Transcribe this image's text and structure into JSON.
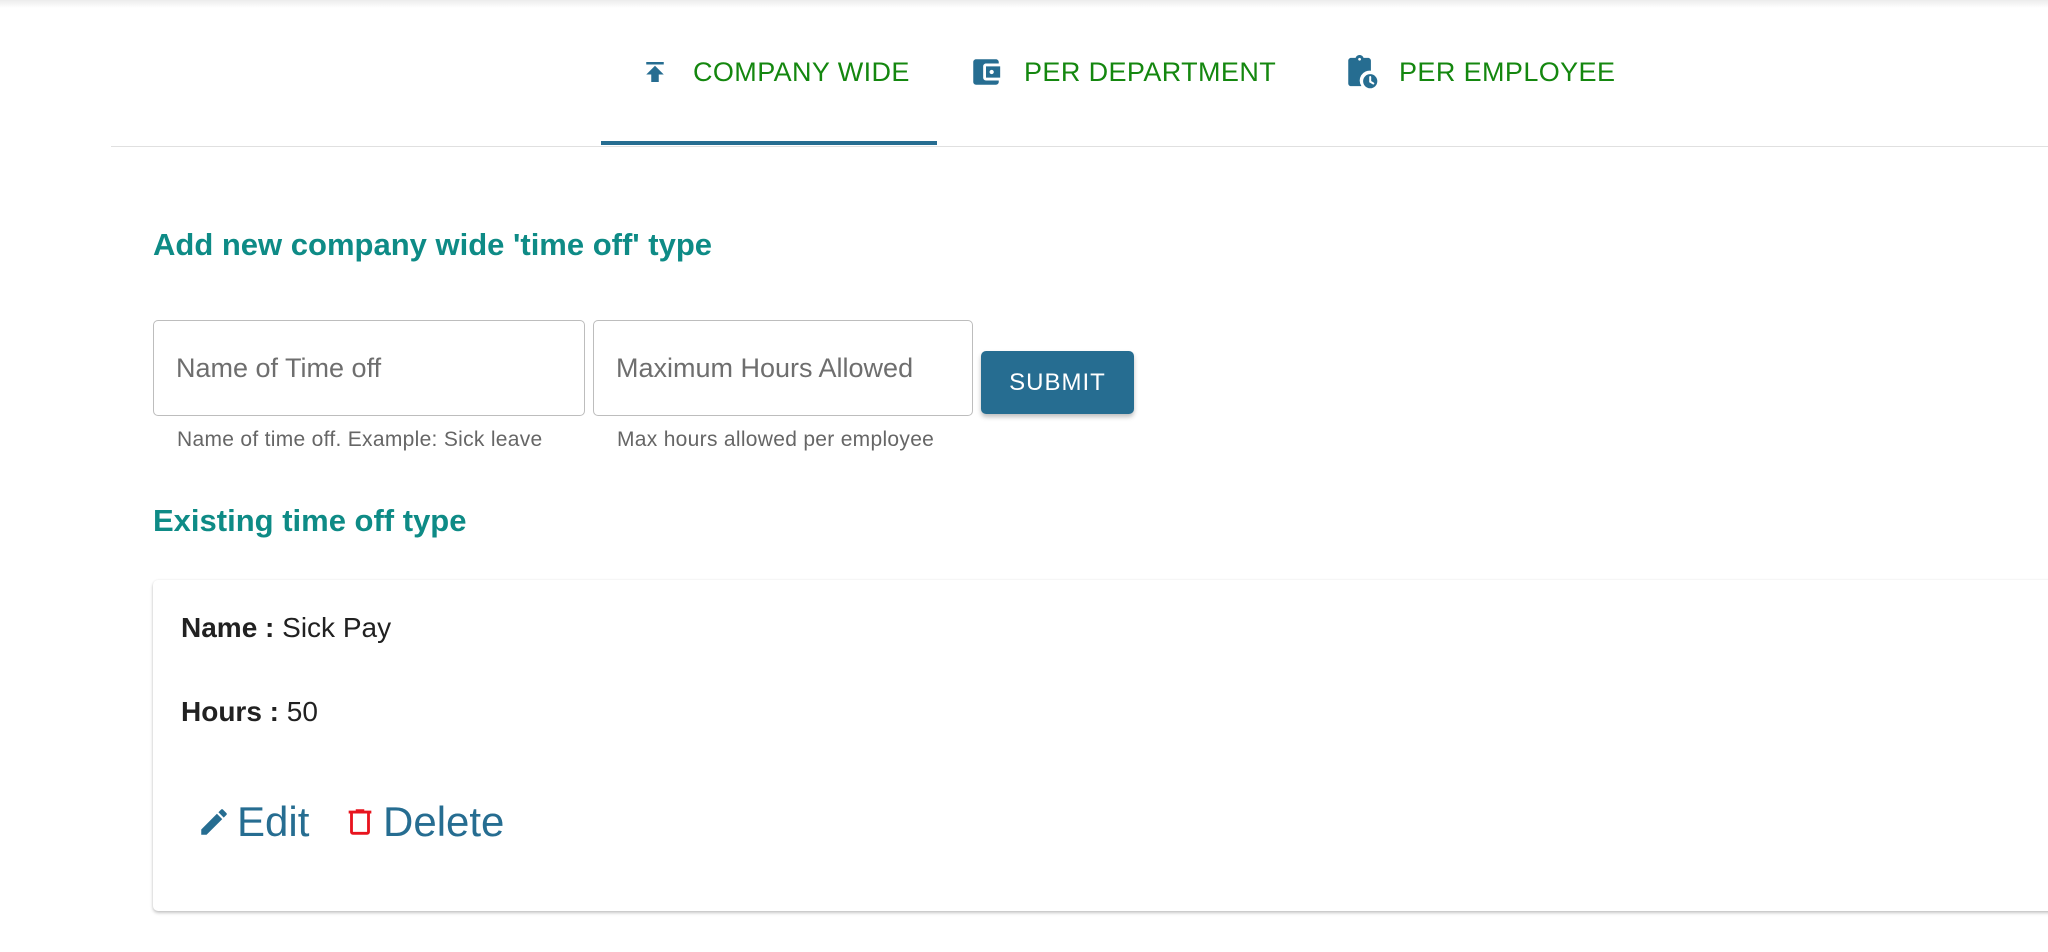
{
  "tabs": [
    {
      "label": "COMPANY WIDE",
      "icon": "upload-icon",
      "active": true
    },
    {
      "label": "PER DEPARTMENT",
      "icon": "wallet-icon",
      "active": false
    },
    {
      "label": "PER EMPLOYEE",
      "icon": "clipboard-clock-icon",
      "active": false
    }
  ],
  "form": {
    "title": "Add new company wide 'time off' type",
    "name_placeholder": "Name of Time off",
    "name_helper": "Name of time off. Example: Sick leave",
    "hours_placeholder": "Maximum Hours Allowed",
    "hours_helper": "Max hours allowed per employee",
    "submit_label": "SUBMIT"
  },
  "existing": {
    "title": "Existing time off type",
    "items": [
      {
        "name_label": "Name :",
        "name": "Sick Pay",
        "hours_label": "Hours :",
        "hours": "50",
        "edit_label": "Edit",
        "delete_label": "Delete"
      }
    ]
  },
  "colors": {
    "primary": "#266d91",
    "tab_text": "#14870f",
    "heading": "#0e8b86",
    "delete_icon": "#e8141e"
  }
}
